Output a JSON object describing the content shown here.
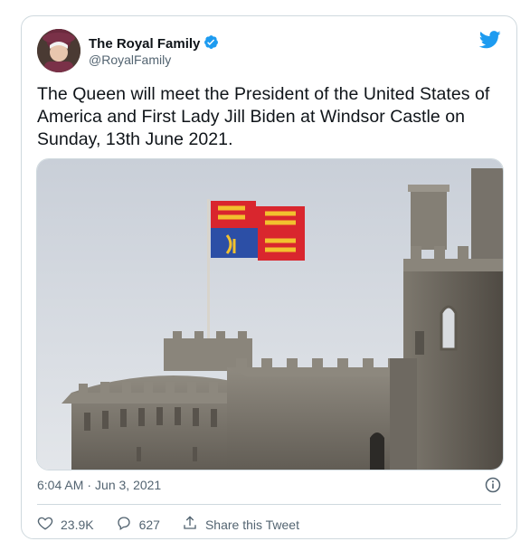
{
  "tweet": {
    "author_name": "The Royal Family",
    "author_handle": "@RoyalFamily",
    "verified": true,
    "text": "The Queen will meet the President of the United States of America and First Lady Jill Biden at Windsor Castle on Sunday, 13th June 2021.",
    "time": "6:04 AM",
    "separator": "·",
    "date": "Jun 3, 2021",
    "like_count": "23.9K",
    "reply_count": "627",
    "share_label": "Share this Tweet"
  },
  "colors": {
    "twitter_blue": "#1d9bf0",
    "text_primary": "#0f1419",
    "text_secondary": "#536471",
    "border": "#cfd9de"
  },
  "icons": [
    "twitter-bird-icon",
    "verified-badge-icon",
    "info-icon",
    "heart-icon",
    "reply-icon",
    "share-icon"
  ]
}
